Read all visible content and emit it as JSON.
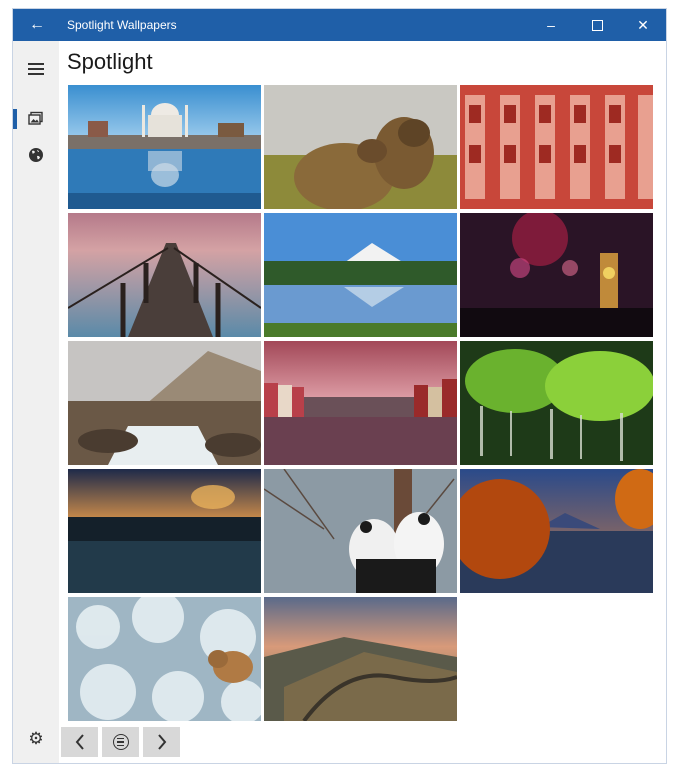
{
  "window": {
    "title": "Spotlight Wallpapers"
  },
  "page": {
    "title": "Spotlight"
  },
  "sidebar": {
    "items": [
      {
        "name": "hamburger-menu",
        "icon": "menu-icon"
      },
      {
        "name": "sidebar-item-wallpapers",
        "icon": "image-gallery-icon",
        "active": true
      },
      {
        "name": "sidebar-item-globe",
        "icon": "globe-icon"
      },
      {
        "name": "sidebar-item-settings",
        "icon": "gear-icon"
      }
    ]
  },
  "gallery": {
    "images": [
      {
        "name": "taj-mahal-reflection",
        "theme": "taj"
      },
      {
        "name": "marmots-cuddling",
        "theme": "marmot"
      },
      {
        "name": "red-palace-facade",
        "theme": "palace"
      },
      {
        "name": "wooden-pier-sunset",
        "theme": "pier"
      },
      {
        "name": "mountain-lake-forest",
        "theme": "lake"
      },
      {
        "name": "fireworks-clock-tower",
        "theme": "fireworks"
      },
      {
        "name": "mountain-waterfall-rocks",
        "theme": "waterfall"
      },
      {
        "name": "colorful-canal-houses",
        "theme": "canal"
      },
      {
        "name": "green-moss-waterfall",
        "theme": "moss"
      },
      {
        "name": "misty-lake-sunrise",
        "theme": "misty"
      },
      {
        "name": "pandas-on-tree",
        "theme": "panda"
      },
      {
        "name": "autumn-mountain-lake",
        "theme": "autumn"
      },
      {
        "name": "hare-in-frost",
        "theme": "hare"
      },
      {
        "name": "hadrians-wall-sunset",
        "theme": "wall"
      }
    ]
  },
  "pager": {
    "prev_icon": "chevron-left-icon",
    "menu_icon": "menu-circle-icon",
    "next_icon": "chevron-right-icon"
  },
  "colors": {
    "accent": "#1f5fa8",
    "sidebar_bg": "#f0f0f0"
  }
}
